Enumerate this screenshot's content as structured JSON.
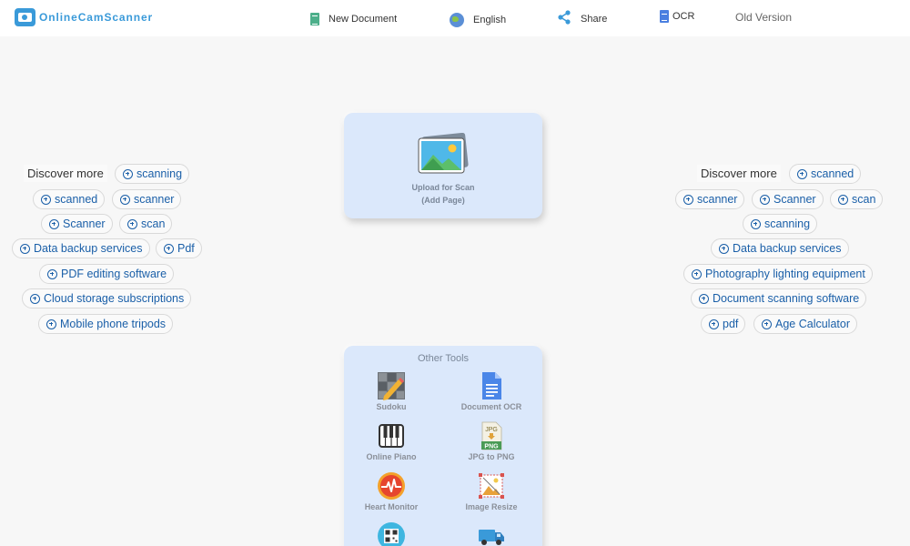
{
  "header": {
    "logo_text": "OnlineCamScanner",
    "nav": {
      "new_document": "New Document",
      "language": "English",
      "share": "Share",
      "ocr": "OCR",
      "old_version": "Old Version"
    }
  },
  "upload": {
    "line1": "Upload for Scan",
    "line2": "(Add Page)"
  },
  "discover_left": {
    "label": "Discover more",
    "chips": [
      "scanning",
      "scanned",
      "scanner",
      "Scanner",
      "scan",
      "Data backup services",
      "Pdf",
      "PDF editing software",
      "Cloud storage subscriptions",
      "Mobile phone tripods"
    ]
  },
  "discover_right": {
    "label": "Discover more",
    "chips": [
      "scanned",
      "scanner",
      "Scanner",
      "scan",
      "scanning",
      "Data backup services",
      "Photography lighting equipment",
      "Document scanning software",
      "pdf",
      "Age Calculator"
    ]
  },
  "other_tools": {
    "title": "Other Tools",
    "items": [
      {
        "label": "Sudoku",
        "icon": "sudoku-icon"
      },
      {
        "label": "Document OCR",
        "icon": "document-ocr-icon"
      },
      {
        "label": "Online Piano",
        "icon": "piano-icon"
      },
      {
        "label": "JPG to PNG",
        "icon": "jpg-png-icon"
      },
      {
        "label": "Heart Monitor",
        "icon": "heart-monitor-icon"
      },
      {
        "label": "Image Resize",
        "icon": "image-resize-icon"
      },
      {
        "label": "",
        "icon": "qr-code-icon"
      },
      {
        "label": "",
        "icon": "truck-icon"
      }
    ],
    "badge_jpg": "JPG",
    "badge_png": "PNG"
  },
  "colors": {
    "brand": "#3a9ad9",
    "chip_text": "#1a5fa8",
    "card_bg": "#dbe8fb"
  }
}
